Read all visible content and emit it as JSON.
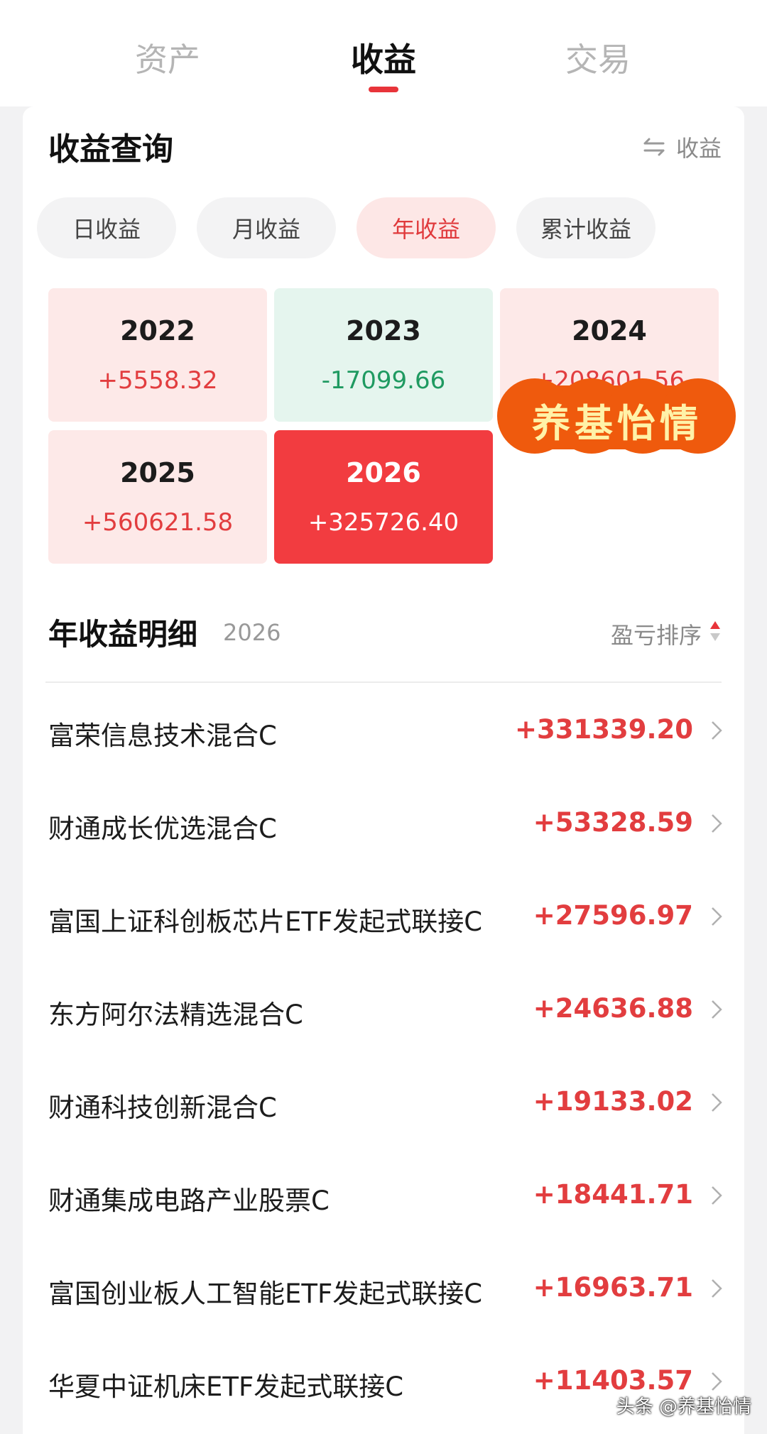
{
  "top_tabs": [
    {
      "label": "资产"
    },
    {
      "label": "收益"
    },
    {
      "label": "交易"
    }
  ],
  "query": {
    "title": "收益查询",
    "switch_label": "收益",
    "switch_icon": "swap-icon"
  },
  "period_chips": [
    {
      "label": "日收益",
      "active": false
    },
    {
      "label": "月收益",
      "active": false
    },
    {
      "label": "年收益",
      "active": true
    },
    {
      "label": "累计收益",
      "active": false
    }
  ],
  "years": [
    {
      "year": "2022",
      "value": "+5558.32"
    },
    {
      "year": "2023",
      "value": "-17099.66"
    },
    {
      "year": "2024",
      "value": "+208601.56"
    },
    {
      "year": "2025",
      "value": "+560621.58"
    },
    {
      "year": "2026",
      "value": "+325726.40",
      "selected": true
    }
  ],
  "stamp_text": "养基怡情",
  "detail": {
    "title": "年收益明细",
    "year": "2026",
    "sort_label": "盈亏排序"
  },
  "funds": [
    {
      "name": "富荣信息技术混合C",
      "amount": "+331339.20"
    },
    {
      "name": "财通成长优选混合C",
      "amount": "+53328.59"
    },
    {
      "name": "富国上证科创板芯片ETF发起式联接C",
      "amount": "+27596.97"
    },
    {
      "name": "东方阿尔法精选混合C",
      "amount": "+24636.88"
    },
    {
      "name": "财通科技创新混合C",
      "amount": "+19133.02"
    },
    {
      "name": "财通集成电路产业股票C",
      "amount": "+18441.71"
    },
    {
      "name": "富国创业板人工智能ETF发起式联接C",
      "amount": "+16963.71"
    },
    {
      "name": "华夏中证机床ETF发起式联接C",
      "amount": "+11403.57"
    }
  ],
  "watermark": "头条 @养基怡情",
  "colors": {
    "accent_red": "#e8343a",
    "gain_red": "#e23d3f",
    "loss_green": "#1f9a61",
    "selected_card": "#f23c40",
    "stamp_orange": "#ef5a0d"
  }
}
